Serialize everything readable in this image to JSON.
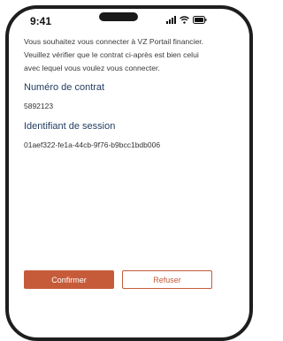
{
  "status_bar": {
    "time": "9:41",
    "icons": [
      "signal-icon",
      "wifi-icon",
      "battery-icon"
    ]
  },
  "intro_text": "Vous souhaitez vous connecter à VZ Portail financier. Veuillez vérifier que le contrat ci-après est bien celui avec lequel vous voulez vous connecter.",
  "contract": {
    "label": "Numéro de contrat",
    "value": "5892123"
  },
  "session": {
    "label": "Identifiant de session",
    "value": "01aef322-fe1a-44cb-9f76-b9bcc1bdb006"
  },
  "actions": {
    "confirm_label": "Confirmer",
    "refuse_label": "Refuser"
  },
  "colors": {
    "accent": "#c65b3a",
    "label": "#1f3a5f"
  }
}
